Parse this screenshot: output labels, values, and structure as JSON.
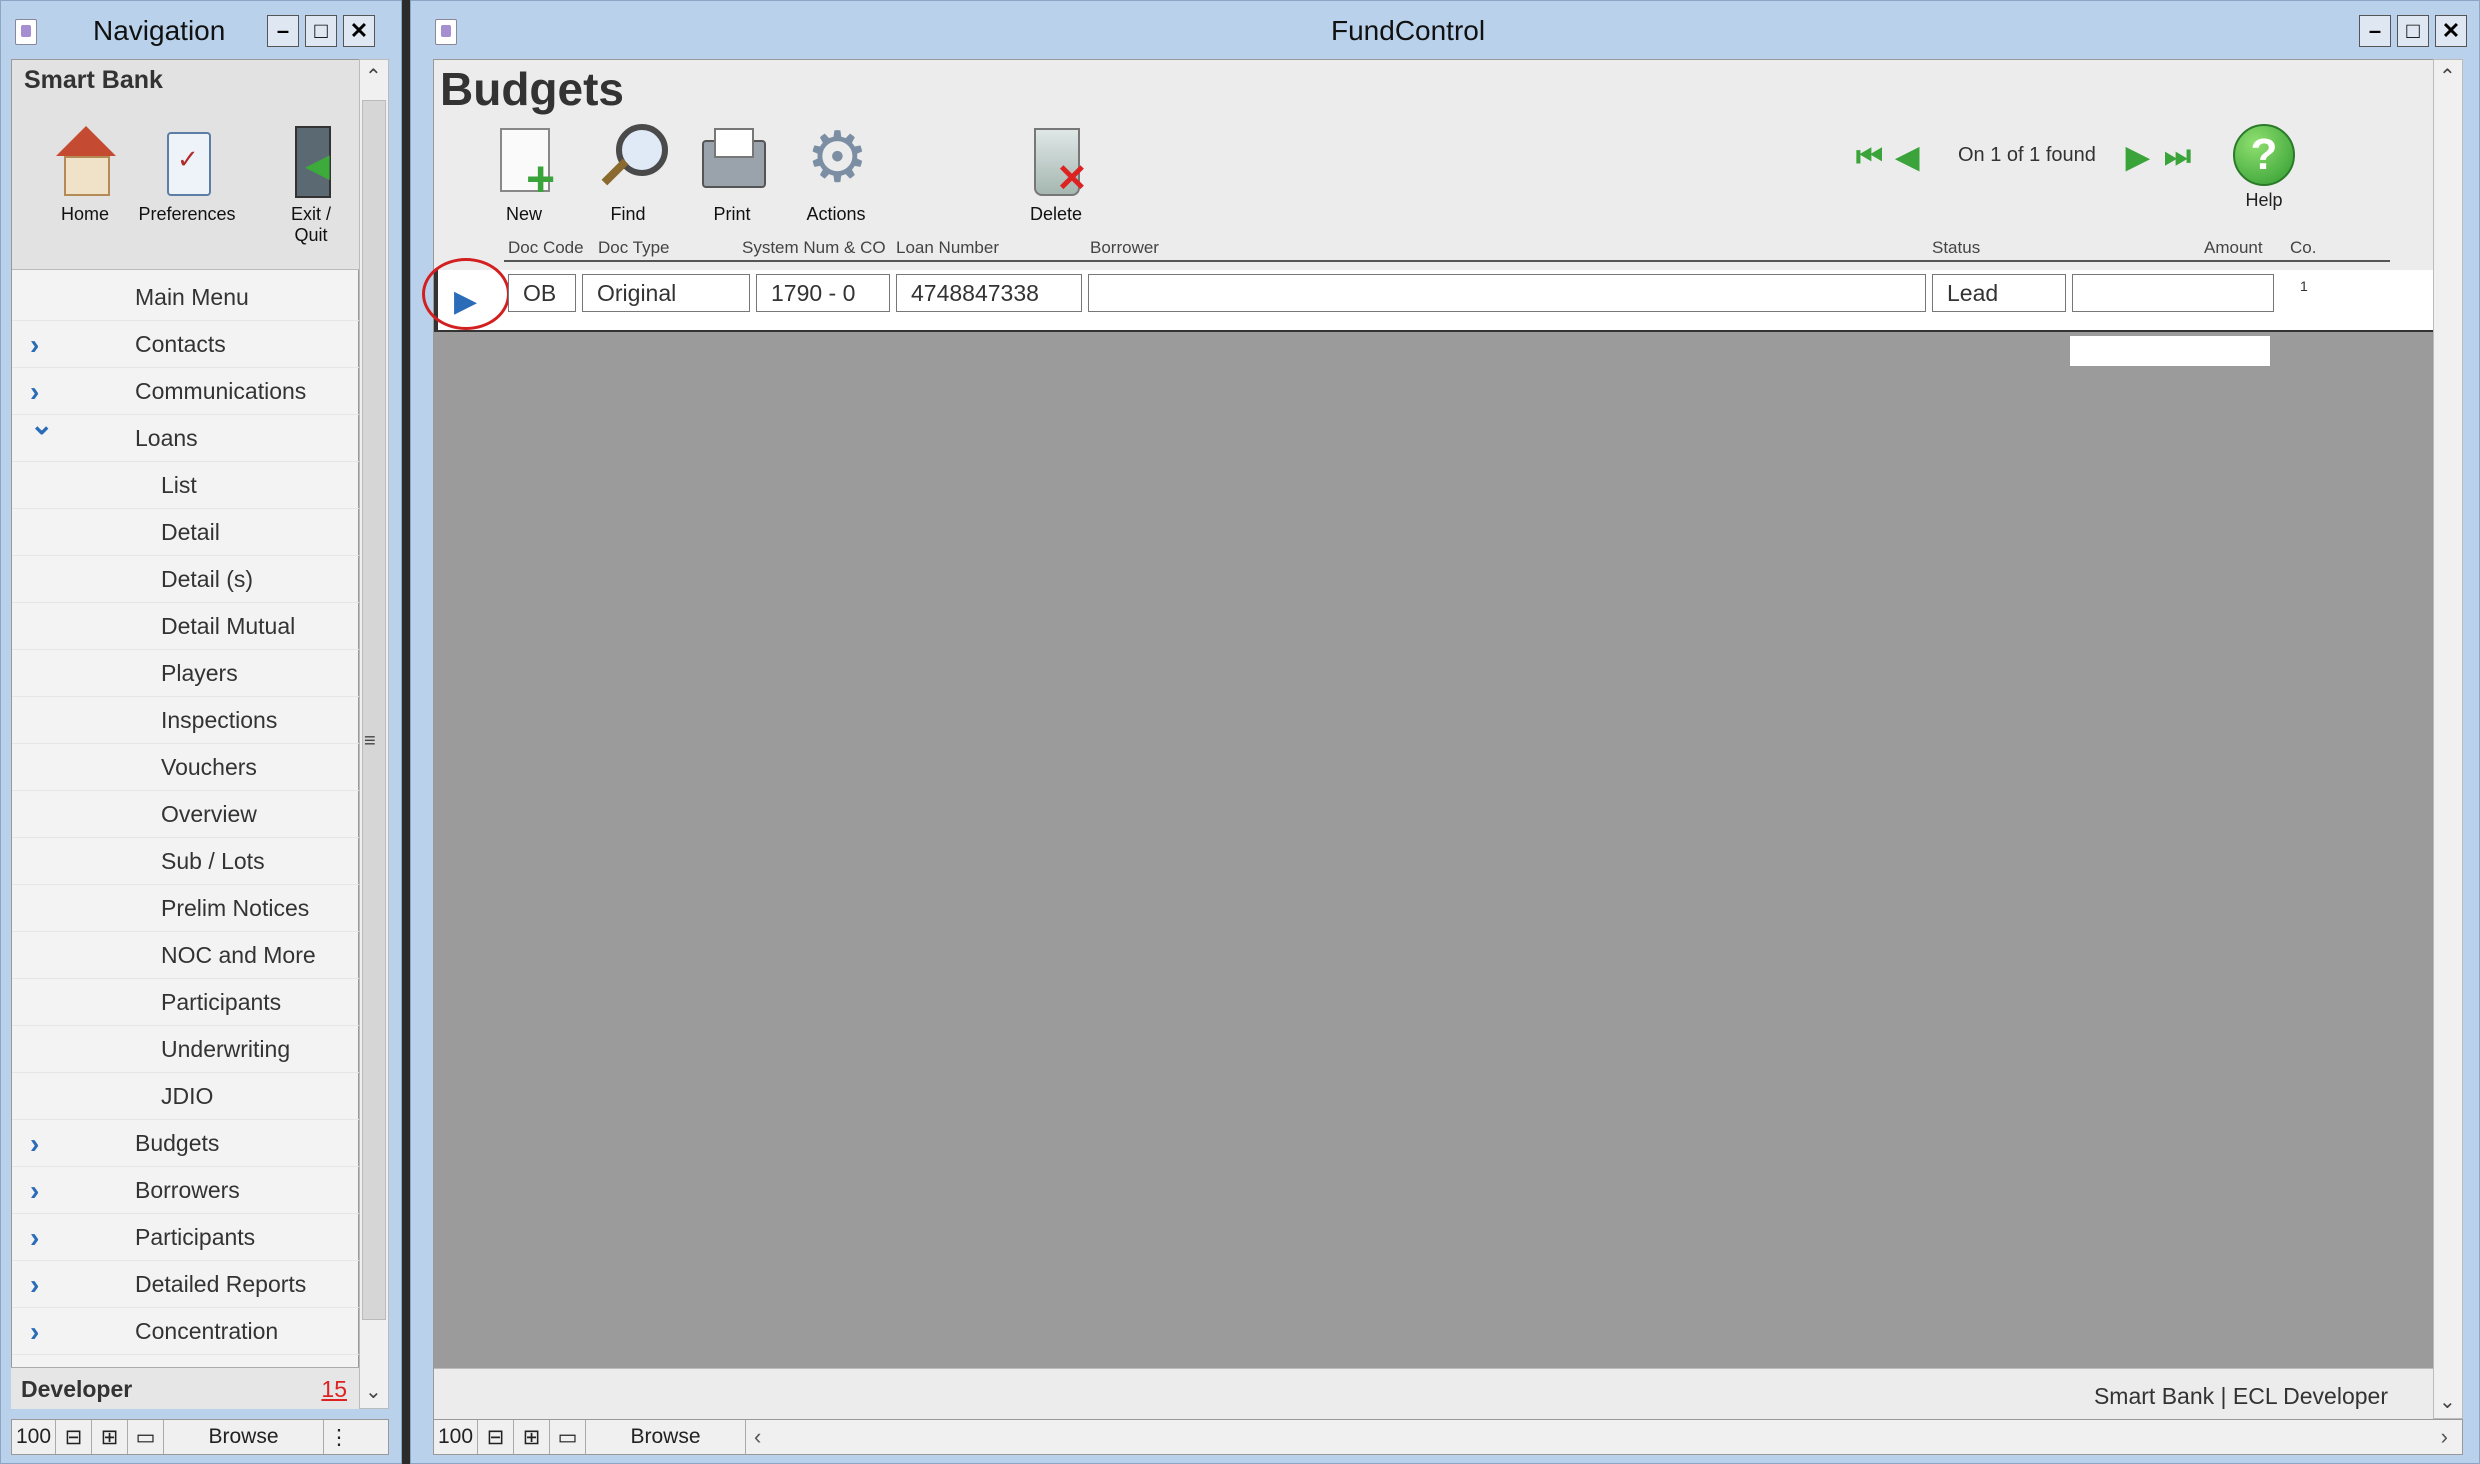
{
  "nav_window": {
    "title": "Navigation",
    "controls": {
      "minimize": "–",
      "maximize": "□",
      "close": "✕"
    },
    "company": "Smart Bank",
    "tools": [
      {
        "label": "Home",
        "icon": "home-icon"
      },
      {
        "label": "Preferences",
        "icon": "preferences-icon"
      },
      {
        "label": "Exit /",
        "label2": "Quit",
        "icon": "exit-icon"
      }
    ],
    "items": [
      {
        "label": "Main Menu"
      },
      {
        "label": "Contacts",
        "chevron": "expand"
      },
      {
        "label": "Communications",
        "chevron": "expand"
      },
      {
        "label": "Loans",
        "chevron": "collapse"
      },
      {
        "label": "List"
      },
      {
        "label": "Detail"
      },
      {
        "label": "Detail (s)"
      },
      {
        "label": "Detail Mutual"
      },
      {
        "label": "Players"
      },
      {
        "label": "Inspections"
      },
      {
        "label": "Vouchers"
      },
      {
        "label": "Overview"
      },
      {
        "label": "Sub / Lots"
      },
      {
        "label": "Prelim Notices"
      },
      {
        "label": "NOC and More"
      },
      {
        "label": "Participants"
      },
      {
        "label": "Underwriting"
      },
      {
        "label": "JDIO"
      },
      {
        "label": "Budgets",
        "chevron": "expand"
      },
      {
        "label": "Borrowers",
        "chevron": "expand"
      },
      {
        "label": "Participants",
        "chevron": "expand"
      },
      {
        "label": "Detailed Reports",
        "chevron": "expand"
      },
      {
        "label": "Concentration",
        "chevron": "expand"
      }
    ],
    "developer_label": "Developer",
    "developer_count": "15",
    "status": {
      "zoom": "100",
      "mode": "Browse"
    }
  },
  "main_window": {
    "title": "FundControl",
    "controls": {
      "minimize": "–",
      "maximize": "□",
      "close": "✕"
    },
    "page_title": "Budgets",
    "toolbar": {
      "new_label": "New",
      "find_label": "Find",
      "print_label": "Print",
      "actions_label": "Actions",
      "delete_label": "Delete",
      "help_label": "Help",
      "help_symbol": "?"
    },
    "record_info": "On 1 of 1 found",
    "columns": {
      "doc_code": "Doc Code",
      "doc_type": "Doc Type",
      "system_num": "System Num & CO",
      "loan_number": "Loan Number",
      "borrower": "Borrower",
      "status": "Status",
      "amount": "Amount",
      "co": "Co."
    },
    "record": {
      "doc_code": "OB",
      "doc_type": "Original",
      "system_num": "1790 - 0",
      "loan_number": "4748847338",
      "borrower": "",
      "status": "Lead",
      "amount": "",
      "co": "1"
    },
    "footer_text": "Smart Bank | ECL Developer",
    "status": {
      "zoom": "100",
      "mode": "Browse"
    }
  }
}
